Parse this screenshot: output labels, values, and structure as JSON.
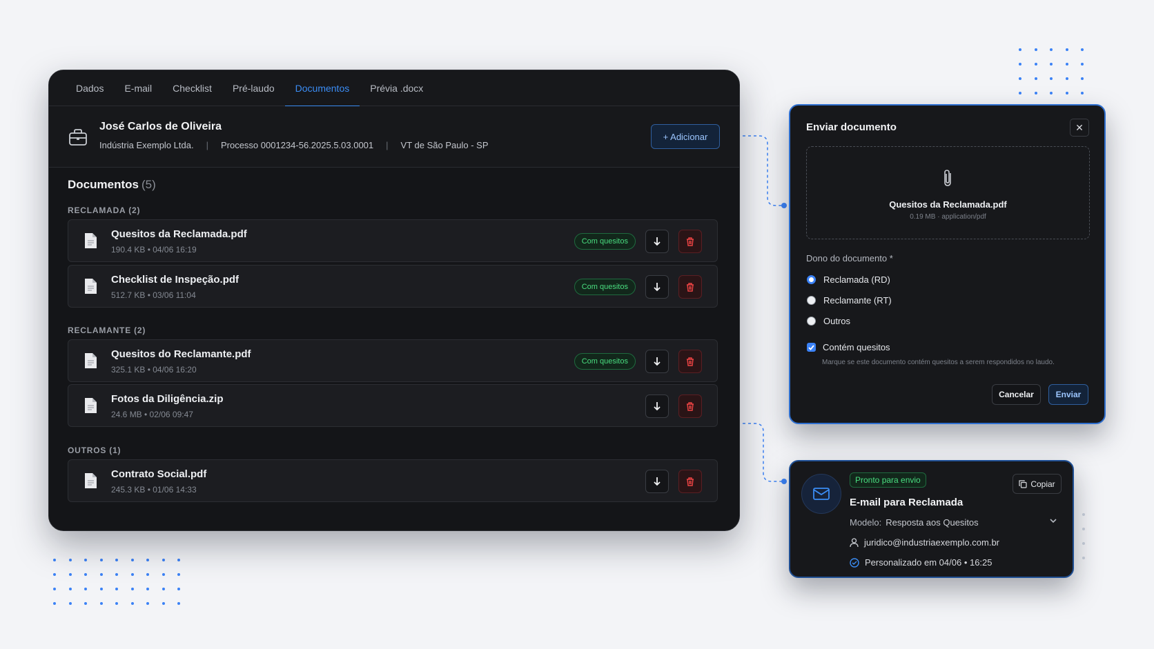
{
  "tabs": [
    {
      "label": "Dados"
    },
    {
      "label": "E-mail"
    },
    {
      "label": "Checklist"
    },
    {
      "label": "Pré-laudo"
    },
    {
      "label": "Documentos",
      "active": true
    },
    {
      "label": "Prévia .docx"
    }
  ],
  "header": {
    "name": "José Carlos de Oliveira",
    "company": "Indústria Exemplo Ltda.",
    "process": "Processo 0001234-56.2025.5.03.0001",
    "court": "VT de São Paulo - SP",
    "separator": "|",
    "add_label": "+ Adicionar"
  },
  "documents": {
    "title": "Documentos",
    "count": "(5)",
    "groups": [
      {
        "label": "RECLAMADA (2)",
        "files": [
          {
            "name": "Quesitos da Reclamada.pdf",
            "meta": "190.4 KB • 04/06 16:19",
            "badge": "Com quesitos"
          },
          {
            "name": "Checklist de Inspeção.pdf",
            "meta": "512.7 KB • 03/06 11:04",
            "badge": "Com quesitos"
          }
        ]
      },
      {
        "label": "RECLAMANTE (2)",
        "files": [
          {
            "name": "Quesitos do Reclamante.pdf",
            "meta": "325.1 KB • 04/06 16:20",
            "badge": "Com quesitos"
          },
          {
            "name": "Fotos da Diligência.zip",
            "meta": "24.6 MB • 02/06 09:47",
            "badge": ""
          }
        ]
      },
      {
        "label": "OUTROS (1)",
        "files": [
          {
            "name": "Contrato Social.pdf",
            "meta": "245.3 KB • 01/06 14:33",
            "badge": ""
          }
        ]
      }
    ]
  },
  "modal": {
    "title": "Enviar documento",
    "close": "✕",
    "file_name": "Quesitos da Reclamada.pdf",
    "file_meta": "0.19 MB · application/pdf",
    "owner_label": "Dono do documento *",
    "options": [
      {
        "label": "Reclamada (RD)",
        "selected": true
      },
      {
        "label": "Reclamante (RT)",
        "selected": false
      },
      {
        "label": "Outros",
        "selected": false
      }
    ],
    "checkbox_label": "Contém quesitos",
    "checkbox_checked": true,
    "help": "Marque se este documento contém quesitos a serem respondidos no laudo.",
    "cancel": "Cancelar",
    "send": "Enviar"
  },
  "email_card": {
    "status": "Pronto para envio",
    "copy": "Copiar",
    "title": "E-mail para Reclamada",
    "model_label": "Modelo:",
    "model_value": "Resposta aos Quesitos",
    "recipient": "juridico@industriaexemplo.com.br",
    "personalized": "Personalizado em 04/06 • 16:25"
  },
  "colors": {
    "accent": "#3b82f6",
    "success": "#4ade80",
    "danger": "#ef4444",
    "panel": "#141518",
    "background": "#f3f4f7"
  }
}
